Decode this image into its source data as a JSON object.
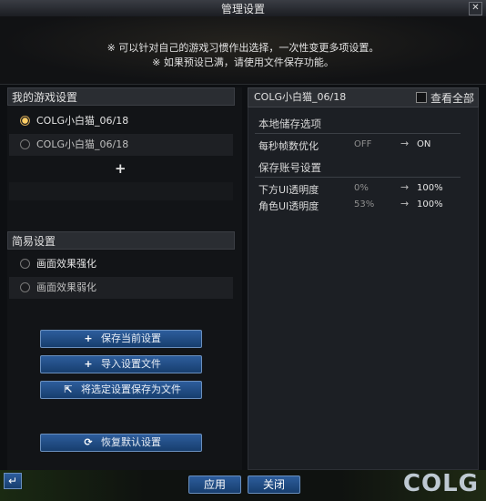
{
  "window": {
    "title": "管理设置",
    "close": "✕"
  },
  "notice": {
    "line1": "※ 可以针对自己的游戏习惯作出选择，一次性变更多项设置。",
    "line2": "※ 如果预设已满，请使用文件保存功能。"
  },
  "left": {
    "my_settings_header": "我的游戏设置",
    "presets": [
      {
        "label": "COLG小白猫_06/18",
        "selected": true
      },
      {
        "label": "COLG小白猫_06/18",
        "selected": false
      }
    ],
    "simple_header": "简易设置",
    "simple": [
      {
        "label": "画面效果强化"
      },
      {
        "label": "画面效果弱化"
      }
    ],
    "buttons": {
      "save_current": "保存当前设置",
      "import_file": "导入设置文件",
      "save_to_file": "将选定设置保存为文件",
      "restore_default": "恢复默认设置"
    }
  },
  "right": {
    "preset_name": "COLG小白猫_06/18",
    "view_all": "查看全部",
    "local_header": "本地储存选项",
    "local_rows": [
      {
        "name": "每秒帧数优化",
        "old": "OFF",
        "new": "ON"
      }
    ],
    "account_header": "保存账号设置",
    "account_rows": [
      {
        "name": "下方UI透明度",
        "old": "0%",
        "new": "100%"
      },
      {
        "name": "角色UI透明度",
        "old": "53%",
        "new": "100%"
      }
    ]
  },
  "footer": {
    "apply": "应用",
    "close": "关闭",
    "watermark": "COLG"
  },
  "colors": {
    "button": "#1f4a80",
    "radio_on": "#ffcf66"
  },
  "icons": [
    "back-icon",
    "plus-icon",
    "export-icon",
    "refresh-icon",
    "checkbox-icon"
  ]
}
